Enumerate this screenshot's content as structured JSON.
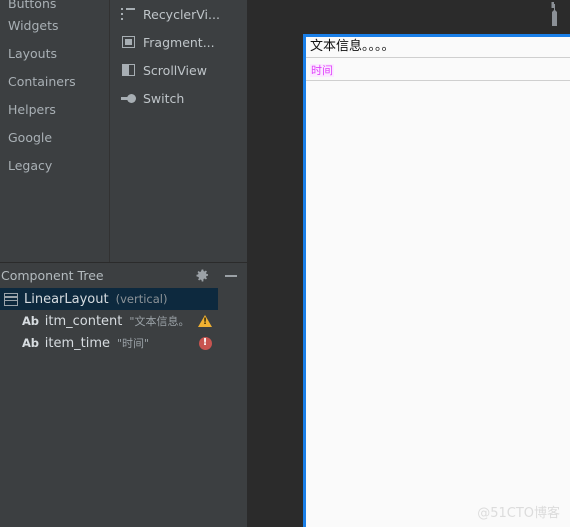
{
  "palette": {
    "groups": [
      {
        "label": "Buttons",
        "clipped": true
      },
      {
        "label": "Widgets"
      },
      {
        "label": "Layouts"
      },
      {
        "label": "Containers"
      },
      {
        "label": "Helpers"
      },
      {
        "label": "Google"
      },
      {
        "label": "Legacy"
      }
    ],
    "items": [
      {
        "label": "RecyclerVi...",
        "icon": "list-icon"
      },
      {
        "label": "Fragment...",
        "icon": "fragment-icon"
      },
      {
        "label": "ScrollView",
        "icon": "scrollview-icon"
      },
      {
        "label": "Switch",
        "icon": "switch-icon"
      }
    ]
  },
  "component_tree": {
    "title": "Component Tree",
    "gear_icon": "gear-icon",
    "minimize_icon": "minimize-icon",
    "nodes": [
      {
        "name": "LinearLayout",
        "sub": "(vertical)",
        "value": "",
        "icon": "linearlayout-icon",
        "type_label": "",
        "selected": true,
        "badge": ""
      },
      {
        "name": "itm_content",
        "sub": "",
        "value": "\"文本信息。",
        "icon": "",
        "type_label": "Ab",
        "selected": false,
        "badge": "warning"
      },
      {
        "name": "item_time",
        "sub": "",
        "value": "\"时间\"",
        "icon": "",
        "type_label": "Ab",
        "selected": false,
        "badge": "error"
      }
    ]
  },
  "editor": {
    "wrench_icon": "wrench-icon",
    "preview": {
      "content_text": "文本信息。。。。",
      "time_text": "时间"
    }
  },
  "watermark": {
    "text": "@51CTO博客"
  },
  "colors": {
    "panel_bg": "#3c3f41",
    "editor_bg": "#2b2b2b",
    "selection_blue": "#0d293e",
    "canvas_border_blue": "#1a7fe8",
    "warning_yellow": "#f0b132",
    "error_red": "#c75450",
    "time_magenta": "#e040fb"
  }
}
